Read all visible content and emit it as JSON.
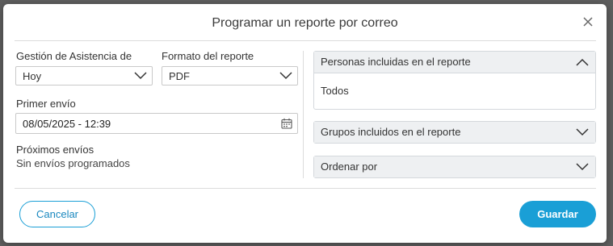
{
  "dialog": {
    "title": "Programar un reporte por correo",
    "close_icon": "close-icon"
  },
  "form": {
    "attendance_label": "Gestión de Asistencia de",
    "attendance_value": "Hoy",
    "format_label": "Formato del reporte",
    "format_value": "PDF",
    "first_send_label": "Primer envío",
    "first_send_value": "08/05/2025 - 12:39",
    "next_sends_label": "Próximos envíos",
    "next_sends_value": "Sin envíos programados"
  },
  "accordions": {
    "people": {
      "title": "Personas incluidas en el reporte",
      "content": "Todos",
      "expanded": true
    },
    "groups": {
      "title": "Grupos incluidos en el reporte",
      "expanded": false
    },
    "order": {
      "title": "Ordenar por",
      "expanded": false
    }
  },
  "footer": {
    "cancel_label": "Cancelar",
    "save_label": "Guardar"
  },
  "colors": {
    "accent": "#1a9fd6",
    "header_bg": "#eef0f2"
  }
}
